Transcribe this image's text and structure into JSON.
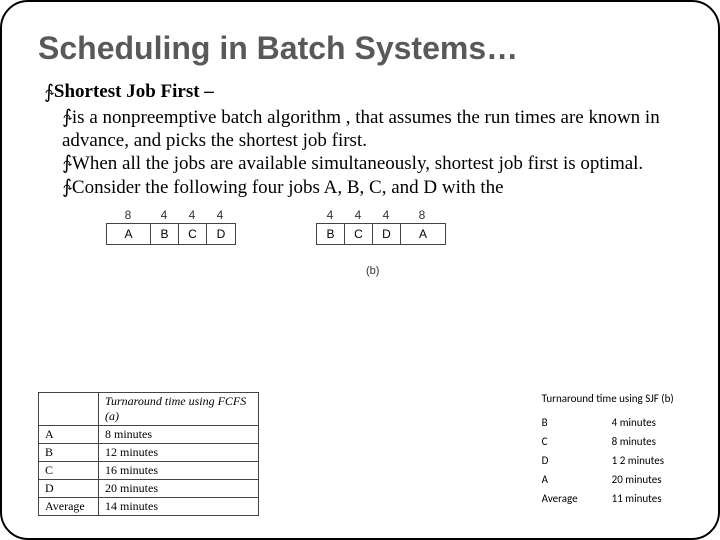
{
  "title": "Scheduling in Batch Systems…",
  "h1": "Shortest Job First –",
  "bullets": [
    "is a  nonpreemptive batch algorithm , that assumes the run times are known in advance, and picks the shortest job first.",
    "When all the jobs are available simultaneously, shortest job first is optimal.",
    "Consider the following four jobs A, B, C, and D with the"
  ],
  "fig": {
    "left": {
      "dur": [
        "8",
        "4",
        "4",
        "4"
      ],
      "lab": [
        "A",
        "B",
        "C",
        "D"
      ]
    },
    "right": {
      "dur": [
        "4",
        "4",
        "4",
        "8"
      ],
      "lab": [
        "B",
        "C",
        "D",
        "A"
      ]
    },
    "caption": "(b)"
  },
  "fcfs": {
    "header": [
      "",
      "Turnaround time using FCFS (a)"
    ],
    "rows": [
      [
        "A",
        "8 minutes"
      ],
      [
        "B",
        "12 minutes"
      ],
      [
        "C",
        "16 minutes"
      ],
      [
        "D",
        "20 minutes"
      ],
      [
        "Average",
        "14 minutes"
      ]
    ]
  },
  "sjf": {
    "header": "Turnaround time using SJF (b)",
    "rows": [
      [
        "B",
        "4 minutes"
      ],
      [
        "C",
        "8 minutes"
      ],
      [
        "D",
        "1 2 minutes"
      ],
      [
        "A",
        "20 minutes"
      ],
      [
        "Average",
        "11 minutes"
      ]
    ]
  }
}
